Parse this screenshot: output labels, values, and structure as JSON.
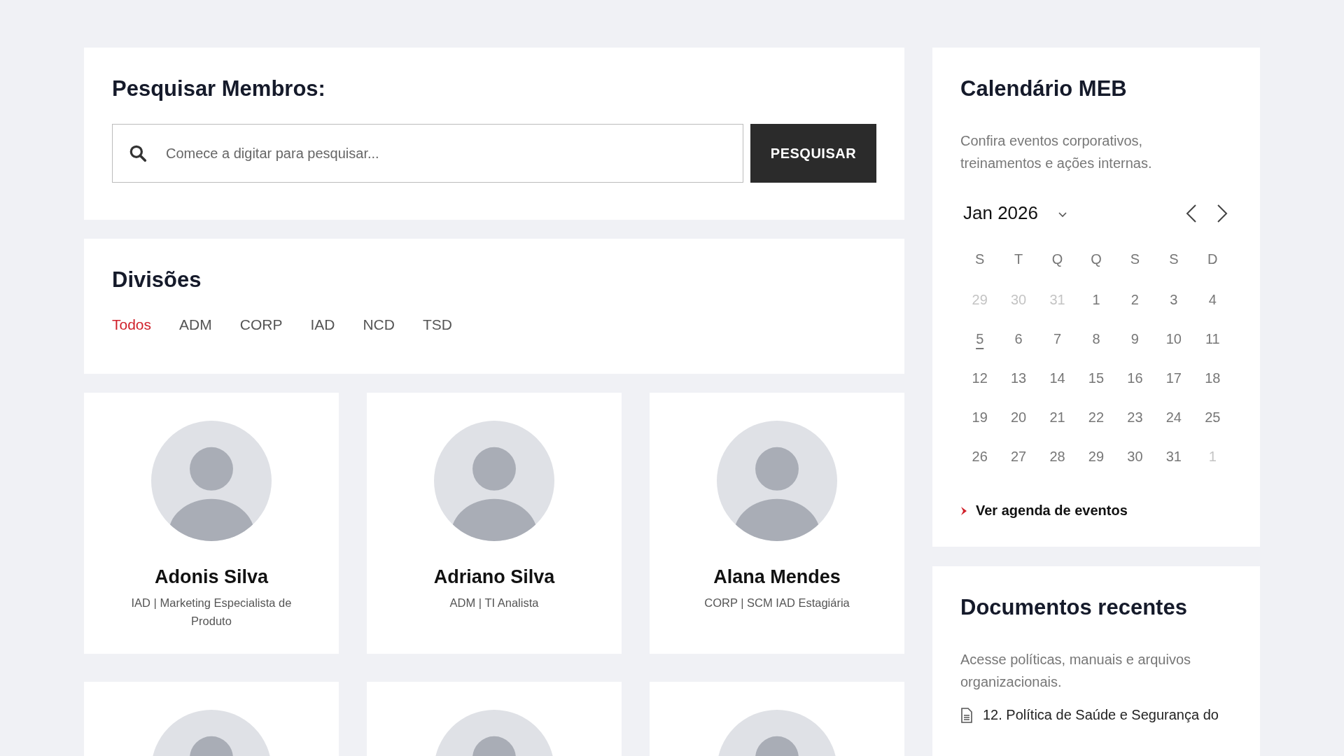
{
  "search": {
    "title": "Pesquisar Membros:",
    "placeholder": "Comece a digitar para pesquisar...",
    "button": "PESQUISAR"
  },
  "divisions": {
    "title": "Divisões",
    "tabs": [
      {
        "label": "Todos",
        "selected": true
      },
      {
        "label": "ADM",
        "selected": false
      },
      {
        "label": "CORP",
        "selected": false
      },
      {
        "label": "IAD",
        "selected": false
      },
      {
        "label": "NCD",
        "selected": false
      },
      {
        "label": "TSD",
        "selected": false
      }
    ]
  },
  "members": [
    {
      "kind": "profile",
      "name": "Adonis Silva",
      "role": "IAD | Marketing Especialista de Produto"
    },
    {
      "kind": "profile",
      "name": "Adriano Silva",
      "role": "ADM | TI Analista"
    },
    {
      "kind": "profile",
      "name": "Alana Mendes",
      "role": "CORP | SCM IAD Estagiária"
    },
    {
      "kind": "photo"
    },
    {
      "kind": "photo"
    },
    {
      "kind": "photo"
    }
  ],
  "calendar": {
    "title": "Calendário MEB",
    "description": "Confira eventos corporativos, treinamentos e ações internas.",
    "month": "Jan 2026",
    "weekdays": [
      "S",
      "T",
      "Q",
      "Q",
      "S",
      "S",
      "D"
    ],
    "weeks": [
      [
        {
          "day": "29",
          "muted": true,
          "today": false
        },
        {
          "day": "30",
          "muted": true,
          "today": false
        },
        {
          "day": "31",
          "muted": true,
          "today": false
        },
        {
          "day": "1",
          "muted": false,
          "today": false
        },
        {
          "day": "2",
          "muted": false,
          "today": false
        },
        {
          "day": "3",
          "muted": false,
          "today": false
        },
        {
          "day": "4",
          "muted": false,
          "today": false
        }
      ],
      [
        {
          "day": "5",
          "muted": false,
          "today": true
        },
        {
          "day": "6",
          "muted": false,
          "today": false
        },
        {
          "day": "7",
          "muted": false,
          "today": false
        },
        {
          "day": "8",
          "muted": false,
          "today": false
        },
        {
          "day": "9",
          "muted": false,
          "today": false
        },
        {
          "day": "10",
          "muted": false,
          "today": false
        },
        {
          "day": "11",
          "muted": false,
          "today": false
        }
      ],
      [
        {
          "day": "12",
          "muted": false,
          "today": false
        },
        {
          "day": "13",
          "muted": false,
          "today": false
        },
        {
          "day": "14",
          "muted": false,
          "today": false
        },
        {
          "day": "15",
          "muted": false,
          "today": false
        },
        {
          "day": "16",
          "muted": false,
          "today": false
        },
        {
          "day": "17",
          "muted": false,
          "today": false
        },
        {
          "day": "18",
          "muted": false,
          "today": false
        }
      ],
      [
        {
          "day": "19",
          "muted": false,
          "today": false
        },
        {
          "day": "20",
          "muted": false,
          "today": false
        },
        {
          "day": "21",
          "muted": false,
          "today": false
        },
        {
          "day": "22",
          "muted": false,
          "today": false
        },
        {
          "day": "23",
          "muted": false,
          "today": false
        },
        {
          "day": "24",
          "muted": false,
          "today": false
        },
        {
          "day": "25",
          "muted": false,
          "today": false
        }
      ],
      [
        {
          "day": "26",
          "muted": false,
          "today": false
        },
        {
          "day": "27",
          "muted": false,
          "today": false
        },
        {
          "day": "28",
          "muted": false,
          "today": false
        },
        {
          "day": "29",
          "muted": false,
          "today": false
        },
        {
          "day": "30",
          "muted": false,
          "today": false
        },
        {
          "day": "31",
          "muted": false,
          "today": false
        },
        {
          "day": "1",
          "muted": true,
          "today": false
        }
      ]
    ],
    "link": "Ver agenda de eventos"
  },
  "documents": {
    "title": "Documentos recentes",
    "description": "Acesse políticas, manuais e arquivos organizacionais.",
    "items": [
      "12. Política de Saúde e Segurança do"
    ]
  }
}
